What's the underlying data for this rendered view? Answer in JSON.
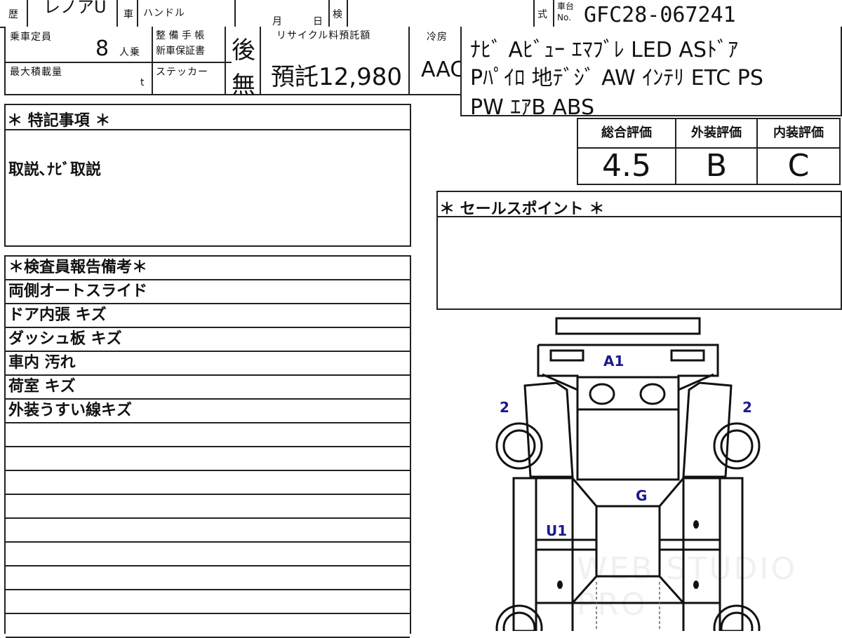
{
  "top_strip": {
    "history_label": "歴",
    "model_fragment": "レノアU",
    "car_label": "車",
    "handle_label": "ハンドル",
    "month_label": "月",
    "day_label": "日",
    "inspection_label": "検",
    "type_label": "式",
    "chassis_label_1": "車台",
    "chassis_label_2": "No.",
    "chassis_number": "GFC28-067241"
  },
  "specs": {
    "capacity_label": "乗車定員",
    "capacity_value": "8",
    "capacity_unit": "人乗",
    "maint_label_1": "整 備 手 帳",
    "maint_label_2": "新車保証書",
    "maint_value": "後",
    "max_load_label": "最大積載量",
    "max_load_unit": "t",
    "sticker_label": "ステッカー",
    "sticker_value": "無",
    "recycle_label": "リサイクル料預託額",
    "recycle_value": "預託12,980",
    "ac_label": "冷房",
    "ac_value": "AAC"
  },
  "equipment": {
    "line1": "ﾅﾋﾞ Aﾋﾞｭｰ ｴﾏﾌﾞﾚ LED ASﾄﾞｱ",
    "line2": "Pﾊﾟｲﾛ 地ﾃﾞｼﾞ AW ｲﾝﾃﾘ ETC PS",
    "line3": "PW ｴｱB ABS"
  },
  "grades": {
    "overall_label": "総合評価",
    "overall_value": "4.5",
    "exterior_label": "外装評価",
    "exterior_value": "B",
    "interior_label": "内装評価",
    "interior_value": "C"
  },
  "special_notes": {
    "title": "＊ 特記事項 ＊",
    "text": "取説､ﾅﾋﾞ取説"
  },
  "sales_points": {
    "title": "＊ セールスポイント ＊"
  },
  "inspector_report": {
    "title": "＊検査員報告備考＊",
    "rows": [
      "両側オートスライド",
      "ドア内張 キズ",
      "ダッシュ板 キズ",
      "車内 汚れ",
      "荷室 キズ",
      "外装うすい線キズ",
      "",
      "",
      "",
      "",
      "",
      "",
      "",
      "",
      ""
    ]
  },
  "diagram_marks": {
    "front": "A1",
    "left_fender": "2",
    "right_fender": "2",
    "floor": "G",
    "left_pillar": "U1"
  },
  "watermark": "WEB STUDIO PRO"
}
